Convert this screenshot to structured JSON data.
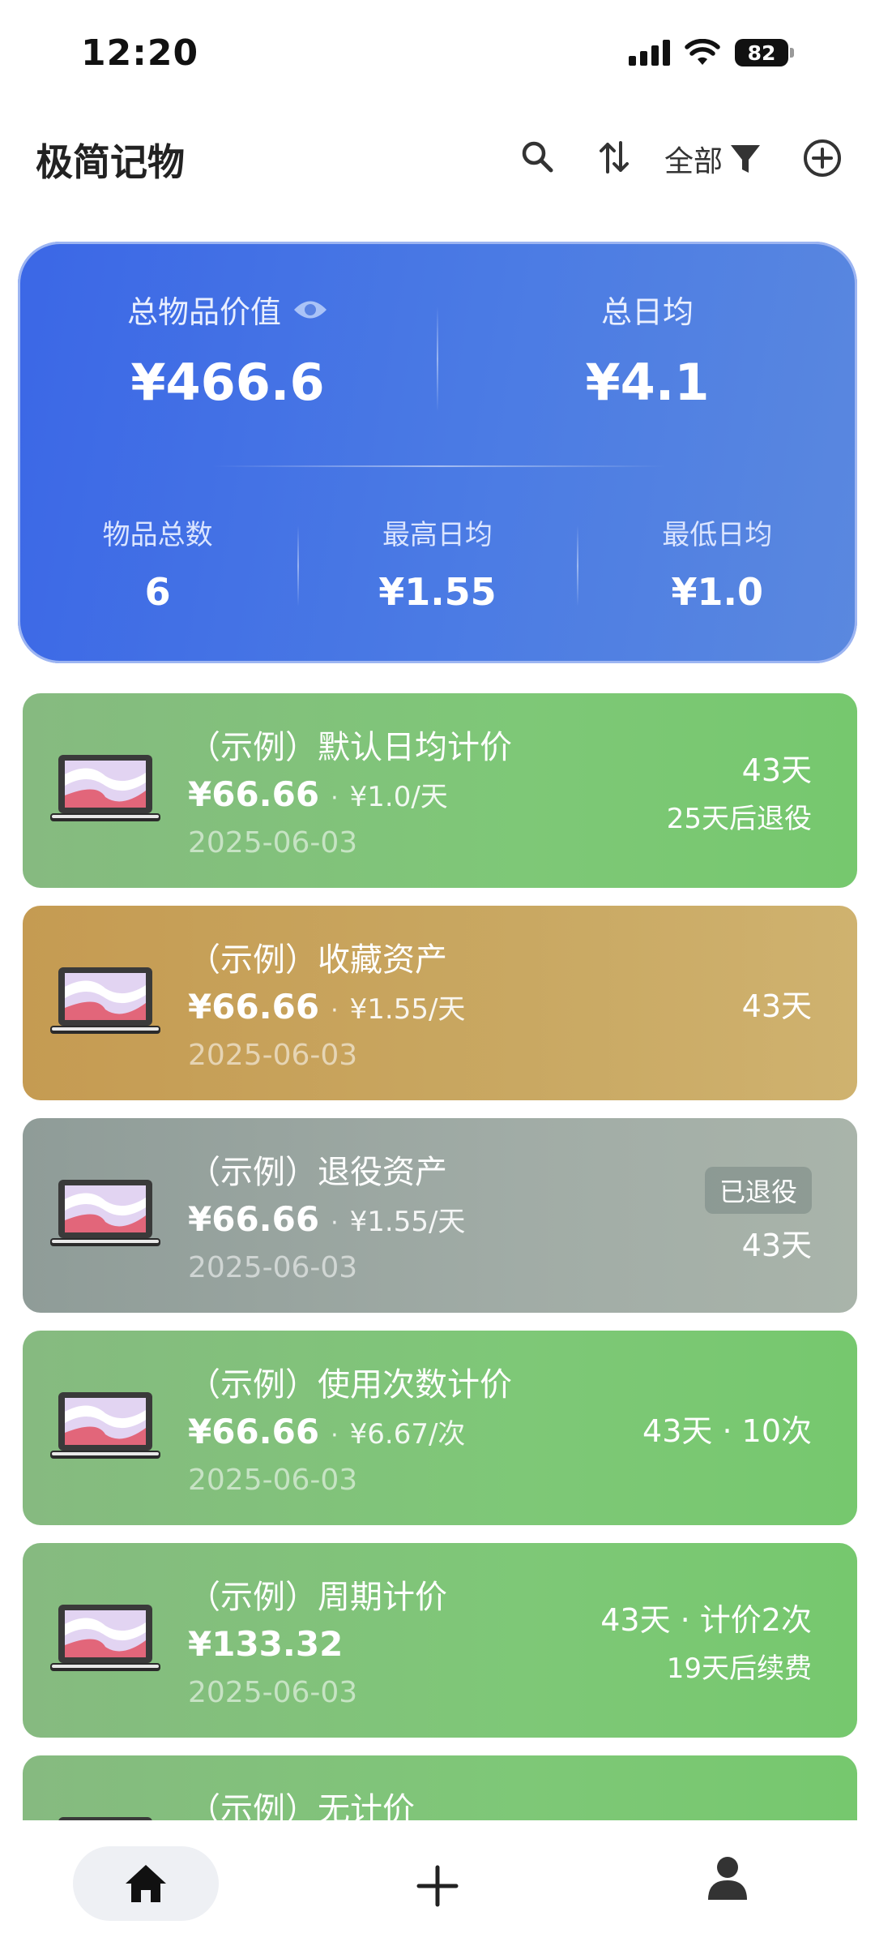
{
  "status_bar": {
    "time": "12:20",
    "battery": "82"
  },
  "header": {
    "title": "极简记物",
    "filter_label": "全部"
  },
  "summary": {
    "total_value_label": "总物品价值",
    "total_value": "¥466.6",
    "daily_avg_label": "总日均",
    "daily_avg": "¥4.1",
    "count_label": "物品总数",
    "count": "6",
    "max_daily_label": "最高日均",
    "max_daily": "¥1.55",
    "min_daily_label": "最低日均",
    "min_daily": "¥1.0"
  },
  "items": [
    {
      "name": "（示例）默认日均计价",
      "price": "¥66.66",
      "sep": "·",
      "rate": "¥1.0/天",
      "date": "2025-06-03",
      "days": "43天",
      "sub": "25天后退役",
      "badge": ""
    },
    {
      "name": "（示例）收藏资产",
      "price": "¥66.66",
      "sep": "·",
      "rate": "¥1.55/天",
      "date": "2025-06-03",
      "days": "43天",
      "sub": "",
      "badge": ""
    },
    {
      "name": "（示例）退役资产",
      "price": "¥66.66",
      "sep": "·",
      "rate": "¥1.55/天",
      "date": "2025-06-03",
      "days": "43天",
      "sub": "",
      "badge": "已退役"
    },
    {
      "name": "（示例）使用次数计价",
      "price": "¥66.66",
      "sep": "·",
      "rate": "¥6.67/次",
      "date": "2025-06-03",
      "days": "43天 · 10次",
      "sub": "",
      "badge": ""
    },
    {
      "name": "（示例）周期计价",
      "price": "¥133.32",
      "sep": "",
      "rate": "",
      "date": "2025-06-03",
      "days": "43天 · 计价2次",
      "sub": "19天后续费",
      "badge": ""
    },
    {
      "name": "（示例）无计价",
      "price": "",
      "sep": "",
      "rate": "",
      "date": "",
      "days": "",
      "sub": "",
      "badge": ""
    }
  ],
  "colors": {
    "card_blue": "#3b67e6",
    "green": "#7ec877",
    "gold": "#c9a862",
    "gray": "#a1aca6"
  }
}
